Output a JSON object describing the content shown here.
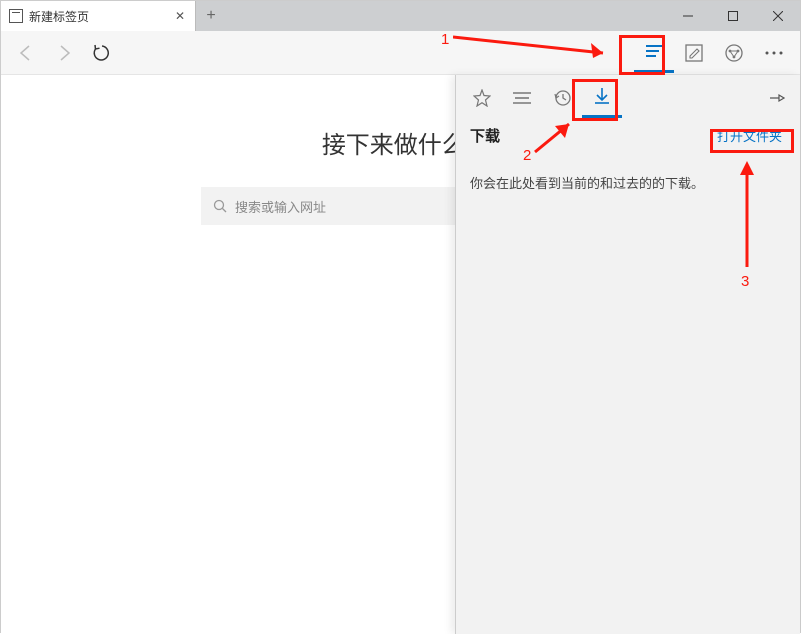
{
  "tab": {
    "title": "新建标签页",
    "close": "✕"
  },
  "newtab_icon": "+",
  "toolbar": {
    "hub_tooltip": "中心",
    "notes_tooltip": "做 Web 笔记",
    "share_tooltip": "共享",
    "more_tooltip": "更多"
  },
  "page": {
    "heading": "接下来做什么?",
    "search_placeholder": "搜索或输入网址"
  },
  "hub": {
    "title": "下载",
    "open_folder": "打开文件夹",
    "empty_text": "你会在此处看到当前的和过去的的下载。"
  },
  "annotations": {
    "n1": "1",
    "n2": "2",
    "n3": "3"
  }
}
